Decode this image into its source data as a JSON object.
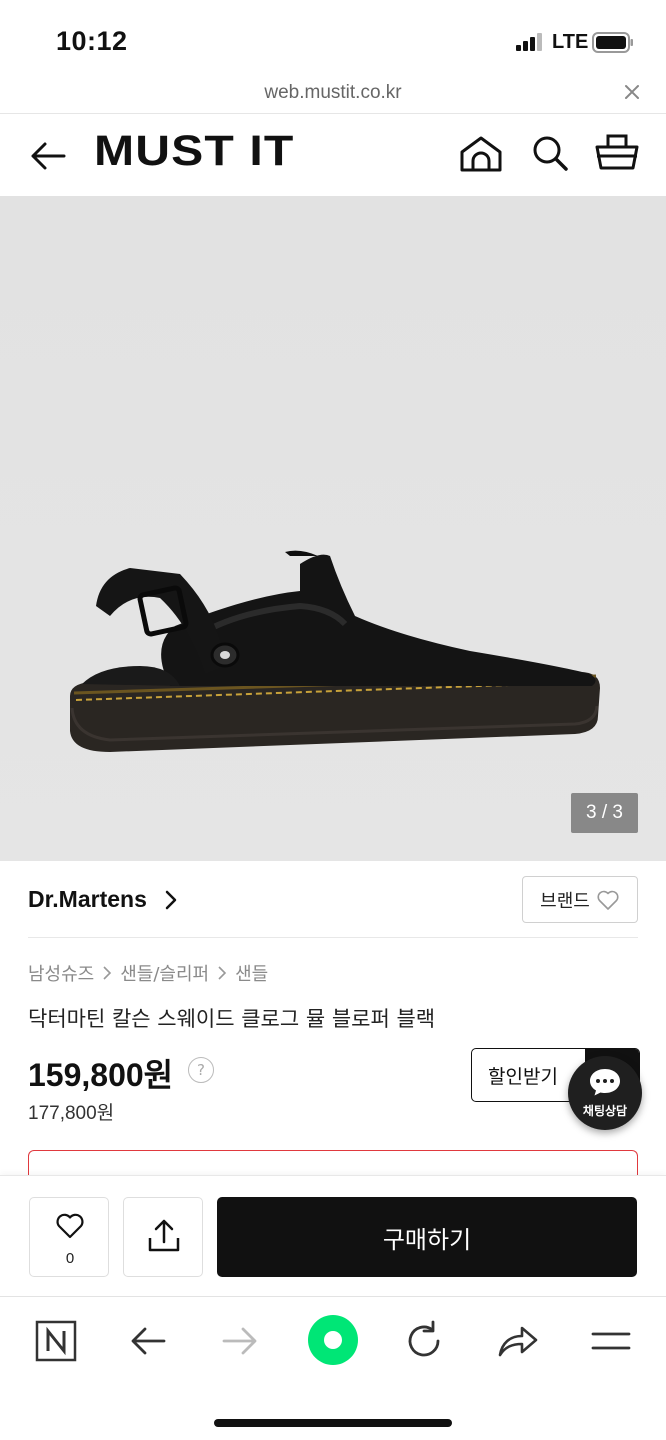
{
  "status_bar": {
    "time": "10:12",
    "network": "LTE"
  },
  "url_bar": {
    "url": "web.mustit.co.kr"
  },
  "header": {
    "logo": "MUST IT"
  },
  "product": {
    "image_counter": "3 / 3",
    "brand": "Dr.Martens",
    "brand_button_label": "브랜드",
    "breadcrumb": [
      "남성슈즈",
      "샌들/슬리퍼",
      "샌들"
    ],
    "title": "닥터마틴 칼슨 스웨이드 클로그 뮬 블로퍼 블랙",
    "price": "159,800원",
    "original_price": "177,800원",
    "price_help": "?",
    "discount_button_label": "할인받기"
  },
  "chat": {
    "label": "채팅상담"
  },
  "purchase_bar": {
    "like_count": "0",
    "buy_label": "구매하기"
  },
  "colors": {
    "accent_red": "#e0393e",
    "toolbar_green": "#00e676",
    "dark": "#111111"
  }
}
